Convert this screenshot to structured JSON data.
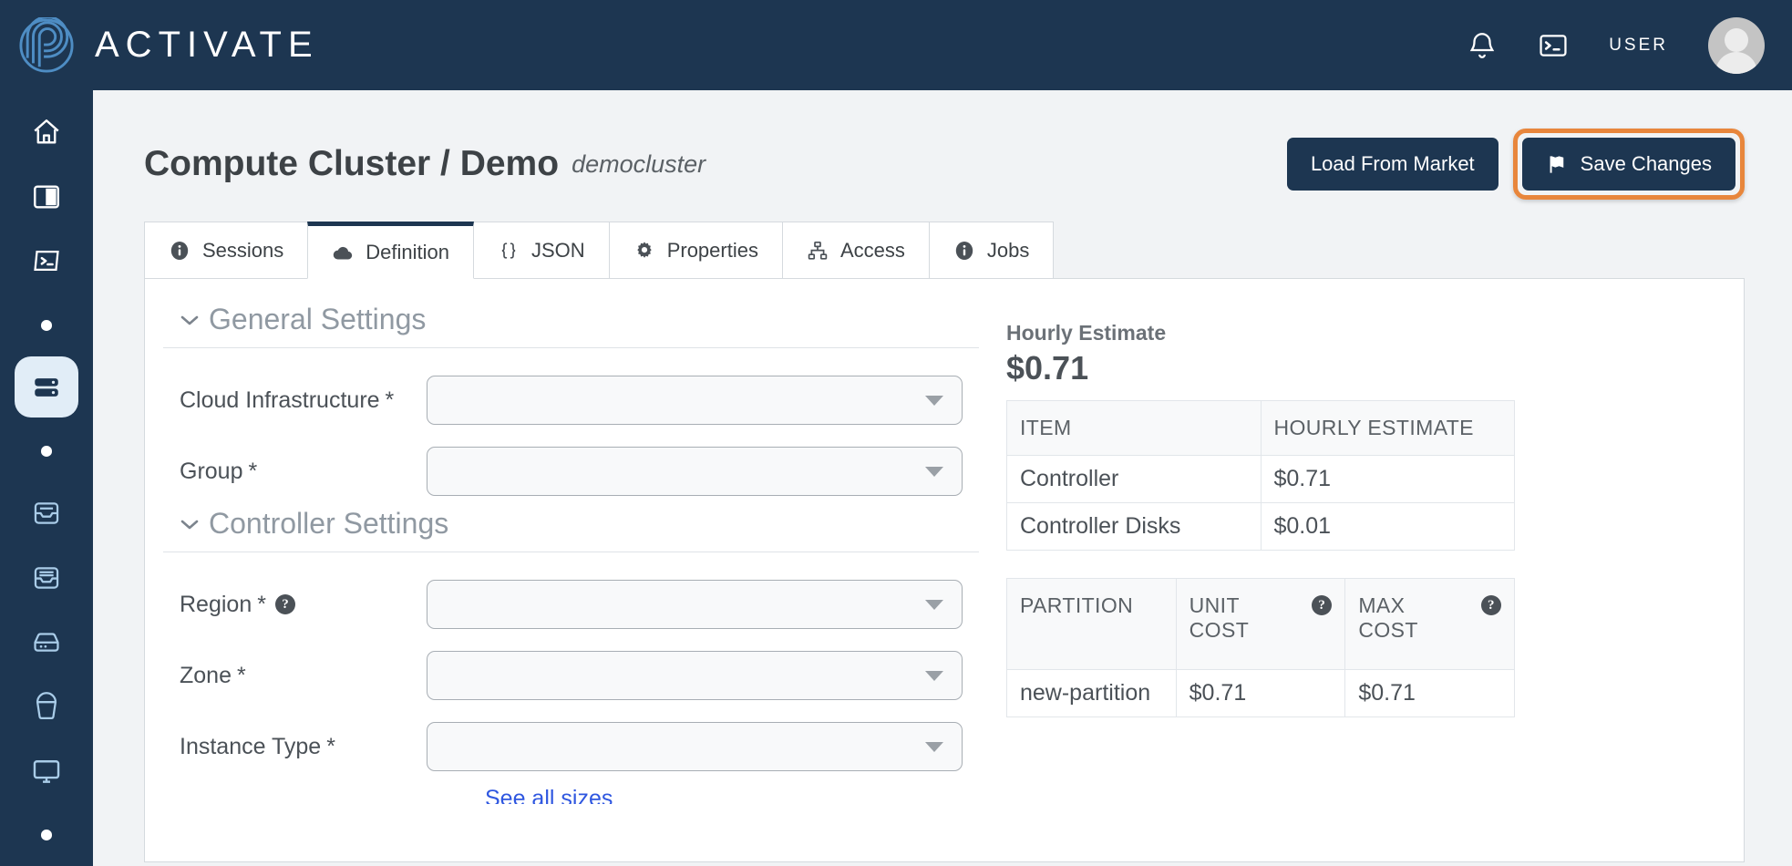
{
  "topbar": {
    "brand_name": "ACTIVATE",
    "logo_icon": "activate-spiral-logo",
    "notifications_icon": "bell-icon",
    "terminal_icon": "terminal-icon",
    "user_label": "USER",
    "avatar_icon": "user-avatar"
  },
  "sidebar": {
    "items": [
      {
        "icon": "home-icon",
        "name": "home",
        "state": "bright"
      },
      {
        "icon": "panel-icon",
        "name": "dashboard",
        "state": "bright"
      },
      {
        "icon": "terminal-skew-icon",
        "name": "terminal",
        "state": "bright"
      },
      {
        "icon": "dot-icon",
        "name": "divider-dot-1",
        "state": "dot"
      },
      {
        "icon": "server-icon",
        "name": "compute-clusters",
        "state": "active"
      },
      {
        "icon": "dot-icon",
        "name": "divider-dot-2",
        "state": "dot"
      },
      {
        "icon": "inbox-icon",
        "name": "inbox-1",
        "state": "dim"
      },
      {
        "icon": "inbox-lines-icon",
        "name": "inbox-2",
        "state": "dim"
      },
      {
        "icon": "hdd-icon",
        "name": "storage",
        "state": "dim"
      },
      {
        "icon": "bucket-icon",
        "name": "buckets",
        "state": "dim"
      },
      {
        "icon": "monitor-icon",
        "name": "desktops",
        "state": "dim"
      },
      {
        "icon": "dot-icon",
        "name": "divider-dot-3",
        "state": "dot"
      }
    ]
  },
  "header": {
    "title": "Compute Cluster / Demo",
    "subtitle": "democluster",
    "load_from_market_label": "Load From Market",
    "save_changes_label": "Save Changes",
    "save_icon": "flag-icon",
    "highlight_color": "#e8863c"
  },
  "tabs": [
    {
      "label": "Sessions",
      "icon": "info-circle-icon",
      "active": false
    },
    {
      "label": "Definition",
      "icon": "cloud-icon",
      "active": true
    },
    {
      "label": "JSON",
      "icon": "braces-icon",
      "active": false
    },
    {
      "label": "Properties",
      "icon": "gear-icon",
      "active": false
    },
    {
      "label": "Access",
      "icon": "sitemap-icon",
      "active": false
    },
    {
      "label": "Jobs",
      "icon": "info-circle-icon",
      "active": false
    }
  ],
  "form": {
    "sections": [
      {
        "title": "General Settings",
        "fields": [
          {
            "label": "Cloud Infrastructure",
            "required": "*",
            "value": "",
            "help": false
          },
          {
            "label": "Group",
            "required": "*",
            "value": "",
            "help": false
          }
        ]
      },
      {
        "title": "Controller Settings",
        "fields": [
          {
            "label": "Region",
            "required": "*",
            "value": "",
            "help": true
          },
          {
            "label": "Zone",
            "required": "*",
            "value": "",
            "help": false
          },
          {
            "label": "Instance Type",
            "required": "*",
            "value": "",
            "help": false,
            "sub_link": "See all sizes"
          }
        ]
      }
    ]
  },
  "estimate": {
    "title": "Hourly Estimate",
    "value": "$0.71",
    "items_table": {
      "headers": [
        "ITEM",
        "HOURLY ESTIMATE"
      ],
      "rows": [
        [
          "Controller",
          "$0.71"
        ],
        [
          "Controller Disks",
          "$0.01"
        ]
      ]
    },
    "partition_table": {
      "headers": [
        {
          "label": "PARTITION",
          "help": false
        },
        {
          "label": "UNIT COST",
          "help": true
        },
        {
          "label": "MAX COST",
          "help": true
        }
      ],
      "rows": [
        [
          "new-partition",
          "$0.71",
          "$0.71"
        ]
      ]
    }
  }
}
